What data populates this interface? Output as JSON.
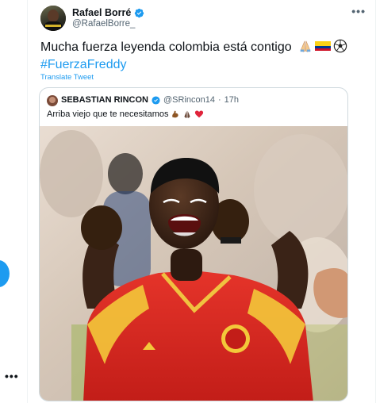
{
  "tweet": {
    "display_name": "Rafael Borré",
    "handle": "@RafaelBorre_",
    "text": "Mucha fuerza leyenda colombia está contigo",
    "hashtag": "#FuerzaFreddy",
    "translate_label": "Translate Tweet",
    "more_label": "•••",
    "emojis": [
      "folded-hands-icon",
      "colombia-flag-icon",
      "soccer-ball-icon"
    ]
  },
  "quote": {
    "display_name": "SEBASTIAN RINCON",
    "handle": "@SRincon14",
    "separator": "·",
    "time": "17h",
    "text": "Arriba viejo que te necesitamos",
    "emojis": [
      "flexed-biceps-icon",
      "folded-hands-icon",
      "red-heart-icon"
    ]
  },
  "left_rail": {
    "more_label": "•••"
  },
  "colors": {
    "accent": "#1d9bf0",
    "text": "#0f1419",
    "muted": "#536471",
    "border": "#cfd9de"
  }
}
